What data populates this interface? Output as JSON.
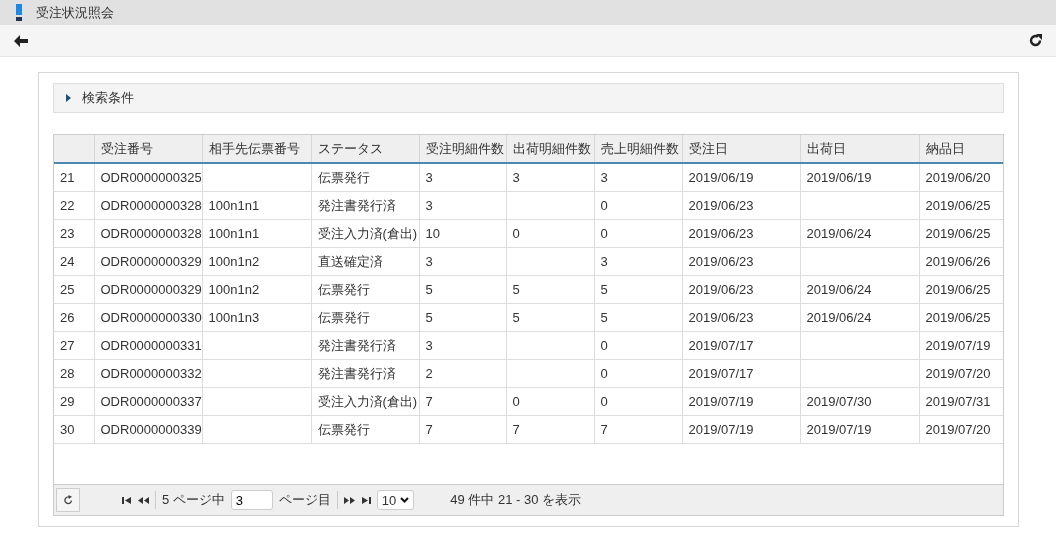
{
  "window": {
    "title": "受注状況照会"
  },
  "search_panel": {
    "label": "検索条件",
    "expanded": false
  },
  "table": {
    "columns": [
      "",
      "受注番号",
      "相手先伝票番号",
      "ステータス",
      "受注明細件数",
      "出荷明細件数",
      "売上明細件数",
      "受注日",
      "出荷日",
      "納品日"
    ],
    "rows": [
      [
        "21",
        "ODR0000000325",
        "",
        "伝票発行",
        "3",
        "3",
        "3",
        "2019/06/19",
        "2019/06/19",
        "2019/06/20"
      ],
      [
        "22",
        "ODR0000000328",
        "100n1n1",
        "発注書発行済",
        "3",
        "",
        "0",
        "2019/06/23",
        "",
        "2019/06/25"
      ],
      [
        "23",
        "ODR0000000328",
        "100n1n1",
        "受注入力済(倉出)",
        "10",
        "0",
        "0",
        "2019/06/23",
        "2019/06/24",
        "2019/06/25"
      ],
      [
        "24",
        "ODR0000000329",
        "100n1n2",
        "直送確定済",
        "3",
        "",
        "3",
        "2019/06/23",
        "",
        "2019/06/26"
      ],
      [
        "25",
        "ODR0000000329",
        "100n1n2",
        "伝票発行",
        "5",
        "5",
        "5",
        "2019/06/23",
        "2019/06/24",
        "2019/06/25"
      ],
      [
        "26",
        "ODR0000000330",
        "100n1n3",
        "伝票発行",
        "5",
        "5",
        "5",
        "2019/06/23",
        "2019/06/24",
        "2019/06/25"
      ],
      [
        "27",
        "ODR0000000331",
        "",
        "発注書発行済",
        "3",
        "",
        "0",
        "2019/07/17",
        "",
        "2019/07/19"
      ],
      [
        "28",
        "ODR0000000332",
        "",
        "発注書発行済",
        "2",
        "",
        "0",
        "2019/07/17",
        "",
        "2019/07/20"
      ],
      [
        "29",
        "ODR0000000337",
        "",
        "受注入力済(倉出)",
        "7",
        "0",
        "0",
        "2019/07/19",
        "2019/07/30",
        "2019/07/31"
      ],
      [
        "30",
        "ODR0000000339",
        "",
        "伝票発行",
        "7",
        "7",
        "7",
        "2019/07/19",
        "2019/07/19",
        "2019/07/20"
      ]
    ]
  },
  "pager": {
    "total_pages": "5 ページ中",
    "page": "3",
    "page_suffix": "ページ目",
    "page_size": "10",
    "summary": "49 件中 21 - 30 を表示"
  }
}
